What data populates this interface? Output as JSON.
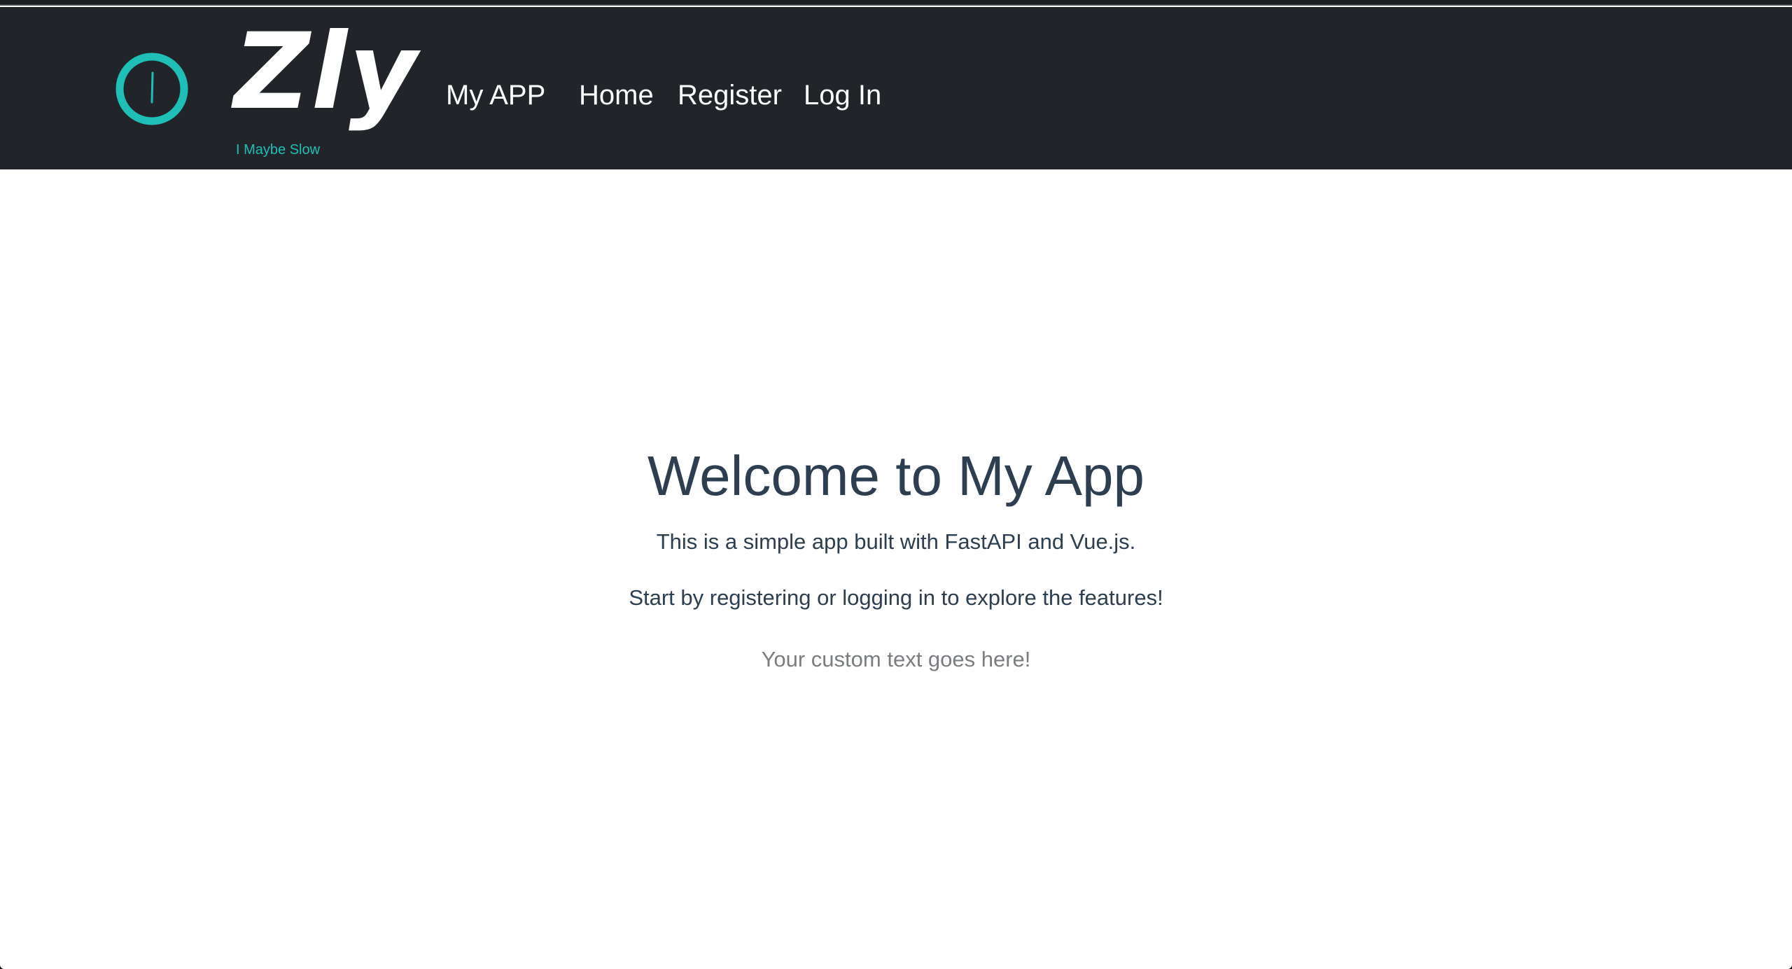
{
  "navbar": {
    "brand_word": "Zly",
    "tagline": "I Maybe Slow",
    "app_name": "My APP",
    "links": [
      {
        "label": "Home"
      },
      {
        "label": "Register"
      },
      {
        "label": "Log In"
      }
    ]
  },
  "hero": {
    "title": "Welcome to My App",
    "line1": "This is a simple app built with FastAPI and Vue.js.",
    "line2": "Start by registering or logging in to explore the features!",
    "custom_text": "Your custom text goes here!"
  },
  "icons": {
    "logo": "clock-ring-icon"
  },
  "colors": {
    "navbar_bg": "#212529",
    "accent": "#1fbfb8",
    "heading_text": "#2c3e50",
    "muted_text": "#7a7d80"
  }
}
